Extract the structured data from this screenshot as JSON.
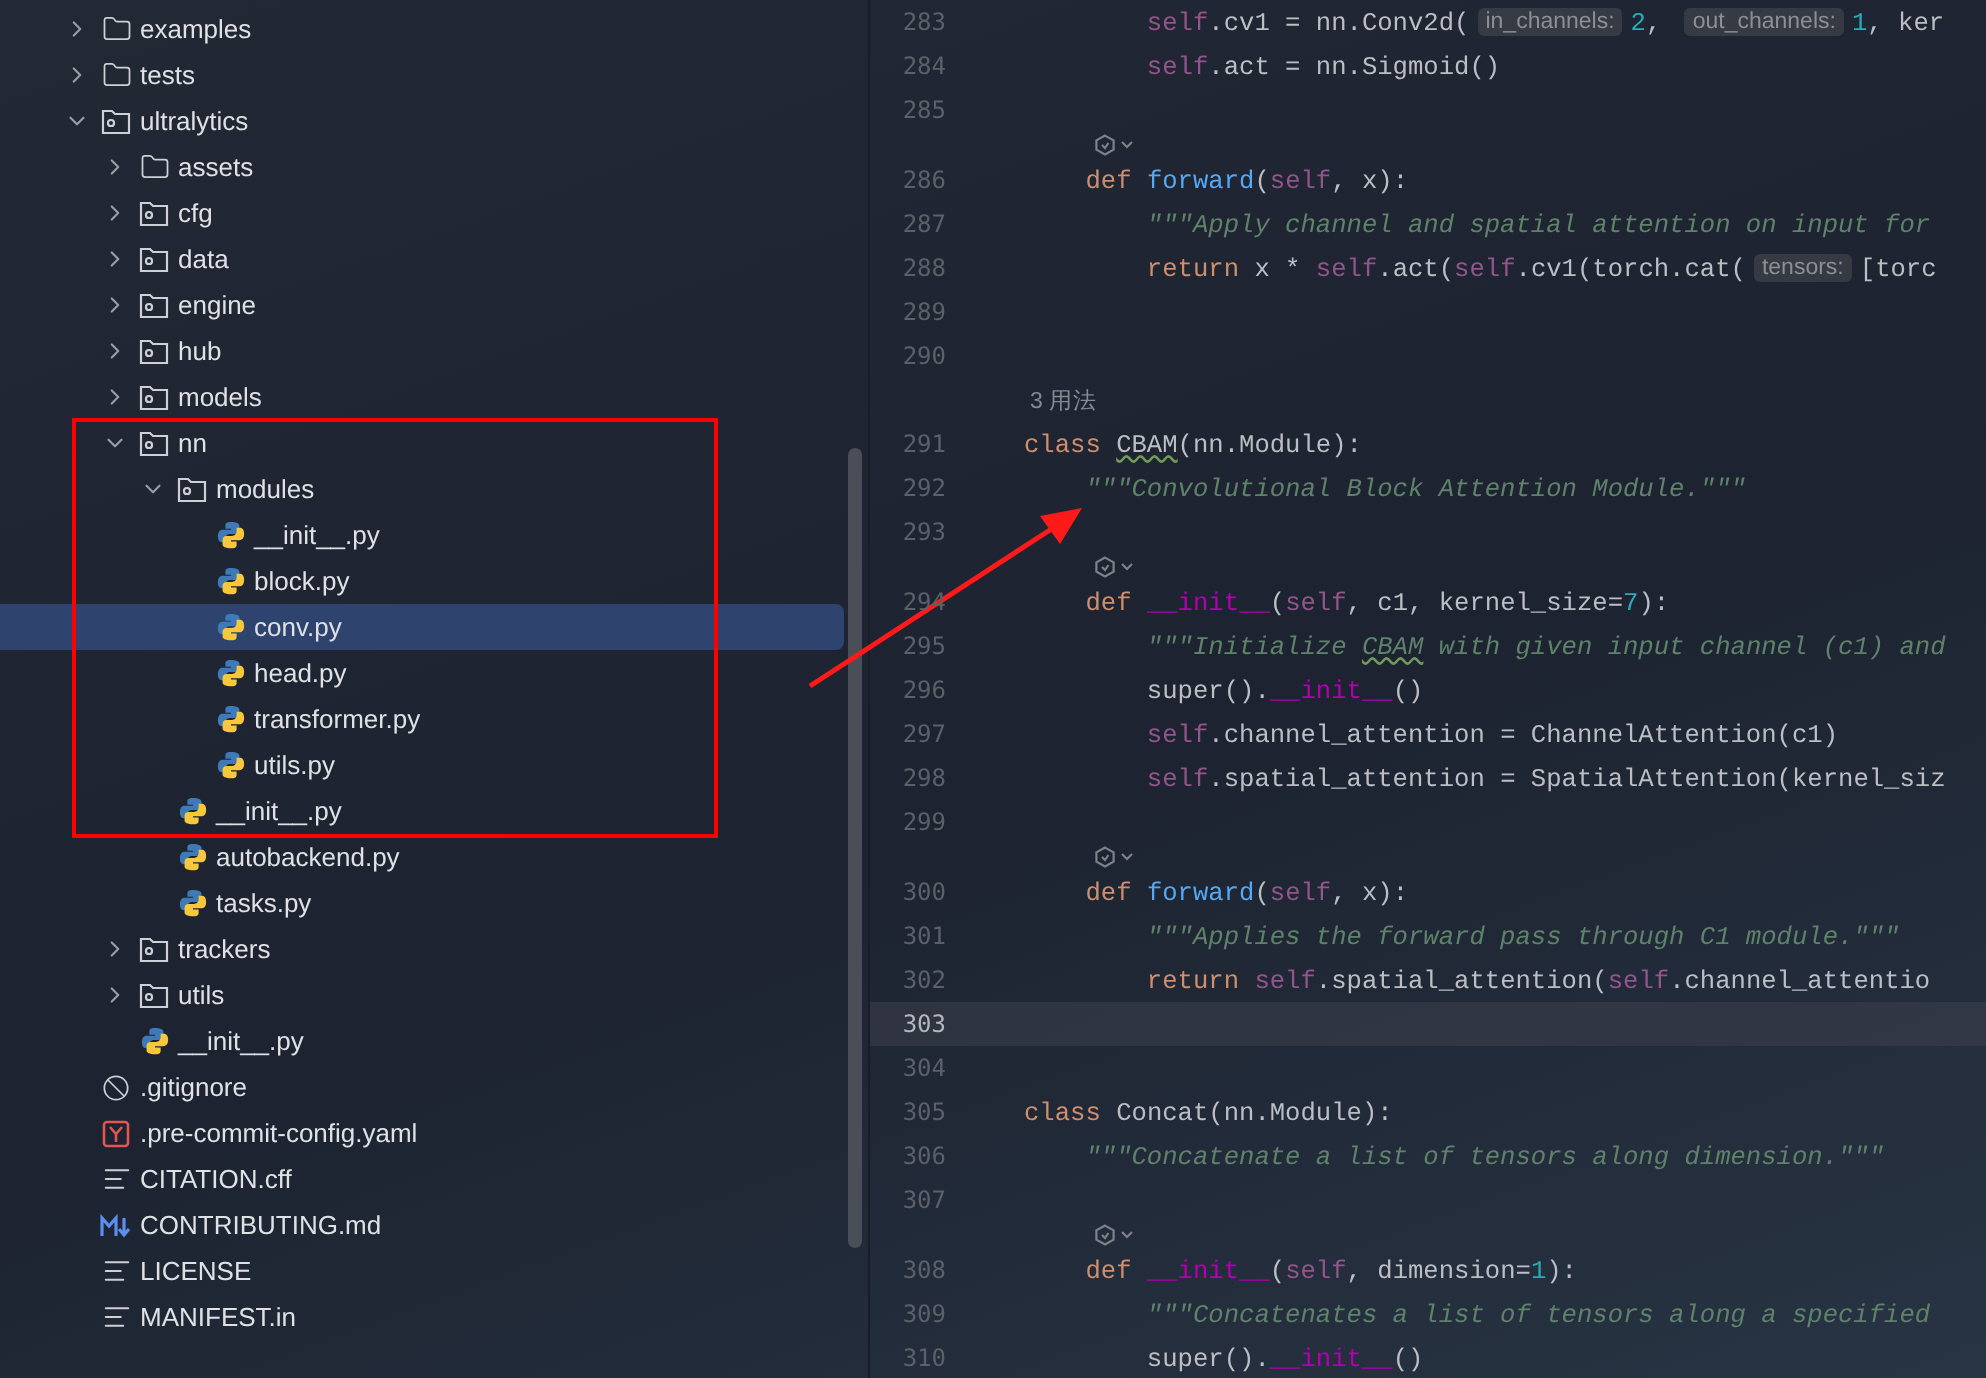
{
  "project_tree": [
    {
      "name": "examples",
      "kind": "folder",
      "expanded": false,
      "selected": false
    },
    {
      "name": "tests",
      "kind": "folder",
      "expanded": false,
      "selected": false
    },
    {
      "name": "ultralytics",
      "kind": "package",
      "expanded": true,
      "selected": false,
      "children": [
        {
          "name": "assets",
          "kind": "folder",
          "expanded": false,
          "selected": false
        },
        {
          "name": "cfg",
          "kind": "package",
          "expanded": false,
          "selected": false
        },
        {
          "name": "data",
          "kind": "package",
          "expanded": false,
          "selected": false
        },
        {
          "name": "engine",
          "kind": "package",
          "expanded": false,
          "selected": false
        },
        {
          "name": "hub",
          "kind": "package",
          "expanded": false,
          "selected": false
        },
        {
          "name": "models",
          "kind": "package",
          "expanded": false,
          "selected": false
        },
        {
          "name": "nn",
          "kind": "package",
          "expanded": true,
          "selected": false,
          "children": [
            {
              "name": "modules",
              "kind": "package",
              "expanded": true,
              "selected": false,
              "children": [
                {
                  "name": "__init__.py",
                  "kind": "python",
                  "selected": false
                },
                {
                  "name": "block.py",
                  "kind": "python",
                  "selected": false
                },
                {
                  "name": "conv.py",
                  "kind": "python",
                  "selected": true
                },
                {
                  "name": "head.py",
                  "kind": "python",
                  "selected": false
                },
                {
                  "name": "transformer.py",
                  "kind": "python",
                  "selected": false
                },
                {
                  "name": "utils.py",
                  "kind": "python",
                  "selected": false
                }
              ]
            },
            {
              "name": "__init__.py",
              "kind": "python",
              "selected": false
            },
            {
              "name": "autobackend.py",
              "kind": "python",
              "selected": false
            },
            {
              "name": "tasks.py",
              "kind": "python",
              "selected": false
            }
          ]
        },
        {
          "name": "trackers",
          "kind": "package",
          "expanded": false,
          "selected": false
        },
        {
          "name": "utils",
          "kind": "package",
          "expanded": false,
          "selected": false
        },
        {
          "name": "__init__.py",
          "kind": "python",
          "selected": false
        }
      ]
    },
    {
      "name": ".gitignore",
      "kind": "ignore",
      "selected": false
    },
    {
      "name": ".pre-commit-config.yaml",
      "kind": "yaml",
      "selected": false
    },
    {
      "name": "CITATION.cff",
      "kind": "text",
      "selected": false
    },
    {
      "name": "CONTRIBUTING.md",
      "kind": "markdown",
      "selected": false
    },
    {
      "name": "LICENSE",
      "kind": "text",
      "selected": false
    },
    {
      "name": "MANIFEST.in",
      "kind": "text",
      "selected": false
    }
  ],
  "editor": {
    "lines": [
      {
        "kind": "code",
        "number": "283",
        "current": false,
        "tokens": [
          {
            "kind": "self",
            "text": "        self"
          },
          {
            "kind": "plain",
            "text": ".cv1 = nn.Conv2d("
          },
          {
            "kind": "hint",
            "text": "in_channels:"
          },
          {
            "kind": "number",
            "text": "2"
          },
          {
            "kind": "plain",
            "text": ", "
          },
          {
            "kind": "hint",
            "text": "out_channels:"
          },
          {
            "kind": "number",
            "text": "1"
          },
          {
            "kind": "plain",
            "text": ", ker"
          }
        ]
      },
      {
        "kind": "code",
        "number": "284",
        "current": false,
        "tokens": [
          {
            "kind": "self",
            "text": "        self"
          },
          {
            "kind": "plain",
            "text": ".act = nn.Sigmoid()"
          }
        ]
      },
      {
        "kind": "code",
        "number": "285",
        "current": false
      },
      {
        "kind": "marker"
      },
      {
        "kind": "code",
        "number": "286",
        "current": false,
        "tokens": [
          {
            "kind": "keyword",
            "text": "    def"
          },
          {
            "kind": "func",
            "text": " forward"
          },
          {
            "kind": "plain",
            "text": "("
          },
          {
            "kind": "self",
            "text": "self"
          },
          {
            "kind": "plain",
            "text": ", x):"
          }
        ]
      },
      {
        "kind": "code",
        "number": "287",
        "current": false,
        "tokens": [
          {
            "kind": "doc",
            "text": "        \"\"\"Apply channel and spatial attention on input for"
          }
        ]
      },
      {
        "kind": "code",
        "number": "288",
        "current": false,
        "tokens": [
          {
            "kind": "keyword",
            "text": "        return"
          },
          {
            "kind": "plain",
            "text": " x * "
          },
          {
            "kind": "self",
            "text": "self"
          },
          {
            "kind": "plain",
            "text": ".act("
          },
          {
            "kind": "self",
            "text": "self"
          },
          {
            "kind": "plain",
            "text": ".cv1(torch.cat("
          },
          {
            "kind": "hint",
            "text": "tensors:"
          },
          {
            "kind": "plain",
            "text": "[torc"
          }
        ]
      },
      {
        "kind": "code",
        "number": "289",
        "current": false
      },
      {
        "kind": "code",
        "number": "290",
        "current": false
      },
      {
        "kind": "usages",
        "text": "3 用法"
      },
      {
        "kind": "code",
        "number": "291",
        "current": false,
        "tokens": [
          {
            "kind": "keyword",
            "text": "class "
          },
          {
            "kind": "typo",
            "text": "CBAM"
          },
          {
            "kind": "plain",
            "text": "(nn.Module):"
          }
        ]
      },
      {
        "kind": "code",
        "number": "292",
        "current": false,
        "tokens": [
          {
            "kind": "doc",
            "text": "    \"\"\"Convolutional Block Attention Module.\"\"\""
          }
        ]
      },
      {
        "kind": "code",
        "number": "293",
        "current": false
      },
      {
        "kind": "marker"
      },
      {
        "kind": "code",
        "number": "294",
        "current": false,
        "tokens": [
          {
            "kind": "keyword",
            "text": "    def "
          },
          {
            "kind": "magic",
            "text": "__init__"
          },
          {
            "kind": "plain",
            "text": "("
          },
          {
            "kind": "self",
            "text": "self"
          },
          {
            "kind": "plain",
            "text": ", c1, kernel_size="
          },
          {
            "kind": "number",
            "text": "7"
          },
          {
            "kind": "plain",
            "text": "):"
          }
        ]
      },
      {
        "kind": "code",
        "number": "295",
        "current": false,
        "tokens": [
          {
            "kind": "doc",
            "text": "        \"\"\"Initialize "
          },
          {
            "kind": "doc-typo",
            "text": "CBAM"
          },
          {
            "kind": "doc",
            "text": " with given input channel (c1) and"
          }
        ]
      },
      {
        "kind": "code",
        "number": "296",
        "current": false,
        "tokens": [
          {
            "kind": "plain",
            "text": "        super()."
          },
          {
            "kind": "magic",
            "text": "__init__"
          },
          {
            "kind": "plain",
            "text": "()"
          }
        ]
      },
      {
        "kind": "code",
        "number": "297",
        "current": false,
        "tokens": [
          {
            "kind": "self",
            "text": "        self"
          },
          {
            "kind": "plain",
            "text": ".channel_attention = ChannelAttention(c1)"
          }
        ]
      },
      {
        "kind": "code",
        "number": "298",
        "current": false,
        "tokens": [
          {
            "kind": "self",
            "text": "        self"
          },
          {
            "kind": "plain",
            "text": ".spatial_attention = SpatialAttention(kernel_siz"
          }
        ]
      },
      {
        "kind": "code",
        "number": "299",
        "current": false
      },
      {
        "kind": "marker"
      },
      {
        "kind": "code",
        "number": "300",
        "current": false,
        "tokens": [
          {
            "kind": "keyword",
            "text": "    def"
          },
          {
            "kind": "func",
            "text": " forward"
          },
          {
            "kind": "plain",
            "text": "("
          },
          {
            "kind": "self",
            "text": "self"
          },
          {
            "kind": "plain",
            "text": ", x):"
          }
        ]
      },
      {
        "kind": "code",
        "number": "301",
        "current": false,
        "tokens": [
          {
            "kind": "doc",
            "text": "        \"\"\"Applies the forward pass through C1 module.\"\"\""
          }
        ]
      },
      {
        "kind": "code",
        "number": "302",
        "current": false,
        "tokens": [
          {
            "kind": "keyword",
            "text": "        return "
          },
          {
            "kind": "self",
            "text": "self"
          },
          {
            "kind": "plain",
            "text": ".spatial_attention("
          },
          {
            "kind": "self",
            "text": "self"
          },
          {
            "kind": "plain",
            "text": ".channel_attentio"
          }
        ]
      },
      {
        "kind": "code",
        "number": "303",
        "current": true
      },
      {
        "kind": "code",
        "number": "304",
        "current": false
      },
      {
        "kind": "code",
        "number": "305",
        "current": false,
        "tokens": [
          {
            "kind": "keyword",
            "text": "class"
          },
          {
            "kind": "plain",
            "text": " Concat(nn.Module):"
          }
        ]
      },
      {
        "kind": "code",
        "number": "306",
        "current": false,
        "tokens": [
          {
            "kind": "doc",
            "text": "    \"\"\"Concatenate a list of tensors along dimension.\"\"\""
          }
        ]
      },
      {
        "kind": "code",
        "number": "307",
        "current": false
      },
      {
        "kind": "marker"
      },
      {
        "kind": "code",
        "number": "308",
        "current": false,
        "tokens": [
          {
            "kind": "keyword",
            "text": "    def "
          },
          {
            "kind": "magic",
            "text": "__init__"
          },
          {
            "kind": "plain",
            "text": "("
          },
          {
            "kind": "self",
            "text": "self"
          },
          {
            "kind": "plain",
            "text": ", dimension="
          },
          {
            "kind": "number",
            "text": "1"
          },
          {
            "kind": "plain",
            "text": "):"
          }
        ]
      },
      {
        "kind": "code",
        "number": "309",
        "current": false,
        "tokens": [
          {
            "kind": "doc",
            "text": "        \"\"\"Concatenates a list of tensors along a specified"
          }
        ]
      },
      {
        "kind": "code",
        "number": "310",
        "current": false,
        "tokens": [
          {
            "kind": "plain",
            "text": "        super()."
          },
          {
            "kind": "magic",
            "text": "__init__"
          },
          {
            "kind": "plain",
            "text": "()"
          }
        ]
      }
    ]
  },
  "annotation": {
    "highlight_box": true,
    "arrow": true
  }
}
